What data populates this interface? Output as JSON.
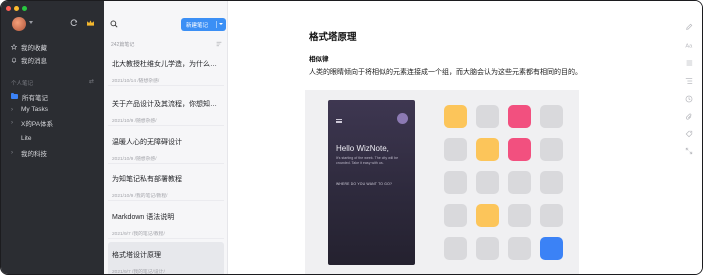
{
  "sidebar": {
    "items": [
      {
        "label": "我的收藏",
        "icon": "star-icon"
      },
      {
        "label": "我的消息",
        "icon": "bell-icon"
      }
    ],
    "section_label": "个人笔记",
    "folders": [
      {
        "label": "所有笔记",
        "icon": "folder-icon"
      },
      {
        "label": "My Tasks",
        "icon": "chevron-right-icon"
      },
      {
        "label": "X的PA体系",
        "icon": "chevron-right-icon"
      },
      {
        "label": "Lite",
        "icon": ""
      },
      {
        "label": "我的科技",
        "icon": "chevron-right-icon"
      }
    ]
  },
  "list": {
    "new_button_label": "新建笔记",
    "count_label": "242篇笔记",
    "notes": [
      {
        "title": "北大教授杜维女儿学造，为什么学...",
        "meta": "2021/10/14   /随想杂感/"
      },
      {
        "title": "关于产品设计及其流程，你想知道...",
        "meta": "2021/10/9   /随想杂感/"
      },
      {
        "title": "温暖人心的无障碍设计",
        "meta": "2021/10/9   /随想杂感/"
      },
      {
        "title": "为知笔记私有部署教程",
        "meta": "2021/10/9   /我的笔记/教程/"
      },
      {
        "title": "Markdown 语法说明",
        "meta": "2021/9/7   /我的笔记/教程/"
      },
      {
        "title": "格式塔设计原理",
        "meta": "2021/9/7   /我的笔记/设计/"
      }
    ]
  },
  "editor": {
    "title": "格式塔原理",
    "heading": "相似律",
    "paragraph": "人类的眼睛倾向于将相似的元素连接成一个组，而大脑会认为这些元素都有相同的目的。",
    "image": {
      "hello": "Hello WizNote,",
      "sub": "It's starting of the week. The city will be crowded. Take it easy with us.",
      "cta": "WHERE DO YOU WANT TO GO?"
    }
  },
  "colors": {
    "accent": "#3b8ff5",
    "sidebar_bg": "#2b2d32",
    "tile_yellow": "#fcc55a",
    "tile_pink": "#f2507f",
    "tile_blue": "#3b82f6",
    "tile_gray": "#d9d9dc"
  },
  "toolbar_icons": [
    "edit-icon",
    "font-icon",
    "list-icon",
    "outline-icon",
    "history-icon",
    "attachment-icon",
    "tag-icon",
    "expand-icon"
  ]
}
